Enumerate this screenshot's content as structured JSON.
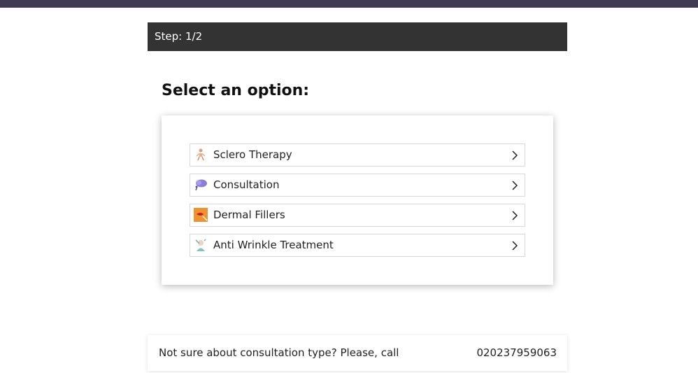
{
  "step": {
    "label": "Step: 1/2"
  },
  "page": {
    "title": "Select an option:"
  },
  "options": [
    {
      "label": "Sclero Therapy",
      "icon": "person-figure-icon"
    },
    {
      "label": "Consultation",
      "icon": "speech-cloud-icon"
    },
    {
      "label": "Dermal Fillers",
      "icon": "lips-filler-icon"
    },
    {
      "label": "Anti Wrinkle Treatment",
      "icon": "face-treatment-icon"
    }
  ],
  "footer": {
    "message": "Not sure about consultation type? Please, call",
    "phone": "020237959063"
  },
  "colors": {
    "topbar": "#403b52",
    "step_bar": "#333333",
    "card_shadow": "rgba(0,0,0,0.28)"
  }
}
